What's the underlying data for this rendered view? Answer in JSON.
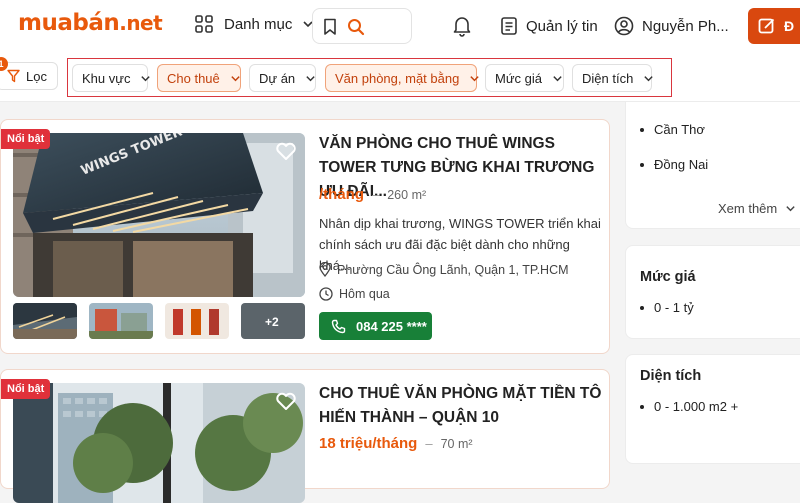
{
  "header": {
    "logo_main": "muabán",
    "logo_suffix": ".net",
    "menu_label": "Danh mục",
    "manage_label": "Quản lý tin",
    "user_name": "Nguyễn Ph...",
    "post_label": "Đ",
    "icons": [
      "grid-icon",
      "chevron-down-icon",
      "bookmark-icon",
      "search-icon",
      "bell-icon",
      "document-icon",
      "user-icon",
      "edit-icon"
    ]
  },
  "filters": {
    "filter_label": "Lọc",
    "filter_count": "1",
    "chips": [
      {
        "label": "Khu vực",
        "active": false
      },
      {
        "label": "Cho thuê",
        "active": true
      },
      {
        "label": "Dự án",
        "active": false
      },
      {
        "label": "Văn phòng, mặt bằng",
        "active": true
      },
      {
        "label": "Mức giá",
        "active": false
      },
      {
        "label": "Diện tích",
        "active": false
      }
    ]
  },
  "listings": [
    {
      "badge": "Nổi bật",
      "title": "VĂN PHÒNG CHO THUÊ WINGS TOWER TƯNG BỪNG KHAI TRƯƠNG ƯU ĐÃI...",
      "price": "/tháng",
      "area": "260 m²",
      "description": "Nhân dịp khai trương, WINGS TOWER triển khai chính sách ưu đãi đặc biệt dành cho những khá...",
      "location": "Phường Cầu Ông Lãnh, Quận 1, TP.HCM",
      "time": "Hôm qua",
      "phone": "084 225 ****",
      "extra_photos": "+2",
      "building_sign": "WINGS TOWER"
    },
    {
      "badge": "Nổi bật",
      "title": "CHO THUÊ VĂN PHÒNG MẶT TIỀN TÔ HIẾN THÀNH – QUẬN 10",
      "price": "18 triệu/tháng",
      "area": "70 m²"
    }
  ],
  "sidebar": {
    "locations": [
      "Cần Thơ",
      "Đồng Nai"
    ],
    "see_more": "Xem thêm",
    "price_title": "Mức giá",
    "price_items": [
      "0 - 1 tỷ"
    ],
    "area_title": "Diện tích",
    "area_items": [
      "0 - 1.000 m2 +"
    ]
  },
  "colors": {
    "brand": "#e8590c",
    "badge": "#e0313a",
    "call": "#188038",
    "highlight_frame": "#d9363e"
  }
}
